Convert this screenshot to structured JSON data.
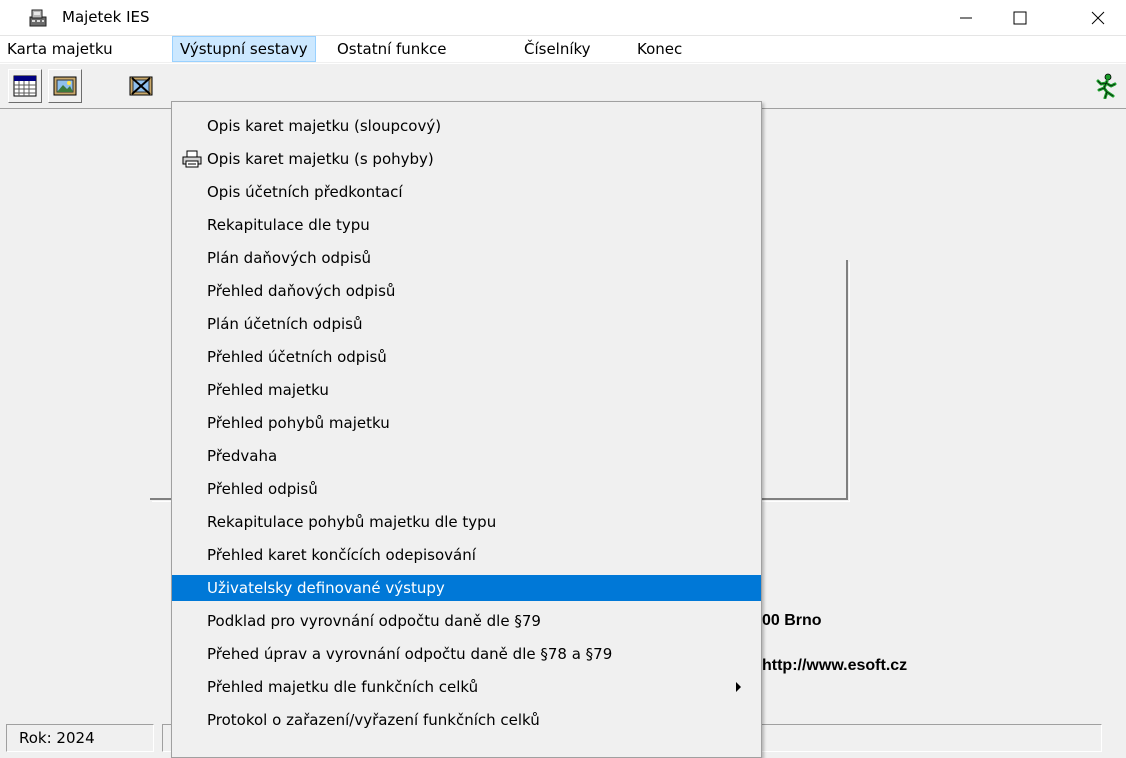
{
  "window": {
    "title": "Majetek IES"
  },
  "menubar": [
    {
      "label": "Karta majetku"
    },
    {
      "label": "Výstupní sestavy"
    },
    {
      "label": "Ostatní funkce"
    },
    {
      "label": "Číselníky"
    },
    {
      "label": "Konec"
    }
  ],
  "dropdown": {
    "items": [
      {
        "label": "Opis karet majetku (sloupcový)"
      },
      {
        "label": "Opis karet majetku (s pohyby)",
        "icon": "printer-icon"
      },
      {
        "label": "Opis účetních předkontací"
      },
      {
        "label": "Rekapitulace dle typu"
      },
      {
        "label": "Plán daňových odpisů"
      },
      {
        "label": "Přehled daňových odpisů"
      },
      {
        "label": "Plán účetních odpisů"
      },
      {
        "label": "Přehled účetních odpisů"
      },
      {
        "label": "Přehled majetku"
      },
      {
        "label": "Přehled pohybů majetku"
      },
      {
        "label": "Předvaha"
      },
      {
        "label": "Přehled odpisů"
      },
      {
        "label": "Rekapitulace pohybů majetku dle typu"
      },
      {
        "label": "Přehled karet končících odepisování"
      },
      {
        "label": "Uživatelsky definované výstupy",
        "highlighted": true
      },
      {
        "label": "Podklad pro vyrovnání odpočtu daně dle §79"
      },
      {
        "label": "Přehed úprav a vyrovnání odpočtu daně dle §78 a §79"
      },
      {
        "label": "Přehled majetku dle funkčních celků",
        "submenu": true
      },
      {
        "label": "Protokol o zařazení/vyřazení funkčních celků"
      }
    ]
  },
  "background": {
    "address": "00 Brno",
    "web": "http://www.esoft.cz"
  },
  "statusbar": {
    "year": "Rok: 2024"
  },
  "icons": {
    "app": "cash-register-icon",
    "toolbar": [
      "calendar-grid-icon",
      "picture-frame-icon",
      "picture-cross-icon",
      "running-man-exit-icon"
    ]
  },
  "colors": {
    "highlight": "#0078d7",
    "menu_open": "#cce8ff",
    "exit_green": "#1a9c2a"
  }
}
